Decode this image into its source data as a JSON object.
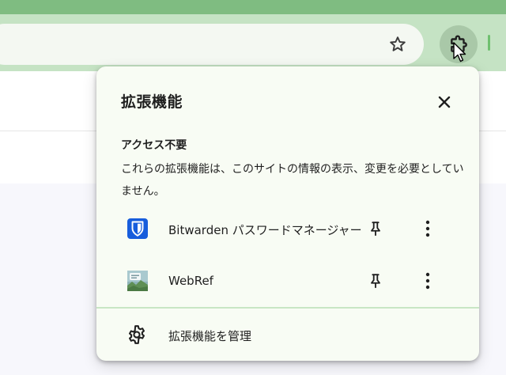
{
  "colors": {
    "tabstrip": "#7fbc81",
    "toolbar": "#c5e3c4",
    "popup_bg": "#f8fcf4",
    "bitwarden_blue": "#175ddc",
    "divider_green": "#c8e6c4"
  },
  "toolbar": {
    "bookmark_icon": "star-outline-icon",
    "extensions_icon": "puzzle-piece-icon"
  },
  "extensions_popup": {
    "title": "拡張機能",
    "close_icon": "close-icon",
    "section": {
      "heading": "アクセス不要",
      "description": "これらの拡張機能は、このサイトの情報の表示、変更を必要としていません。"
    },
    "items": [
      {
        "name": "Bitwarden パスワードマネージャー",
        "icon": "bitwarden-shield-icon",
        "pin_icon": "pin-icon",
        "menu_icon": "more-vert-icon"
      },
      {
        "name": "WebRef",
        "icon": "webref-logo-icon",
        "pin_icon": "pin-icon",
        "menu_icon": "more-vert-icon"
      }
    ],
    "manage": {
      "label": "拡張機能を管理",
      "icon": "gear-icon"
    }
  }
}
